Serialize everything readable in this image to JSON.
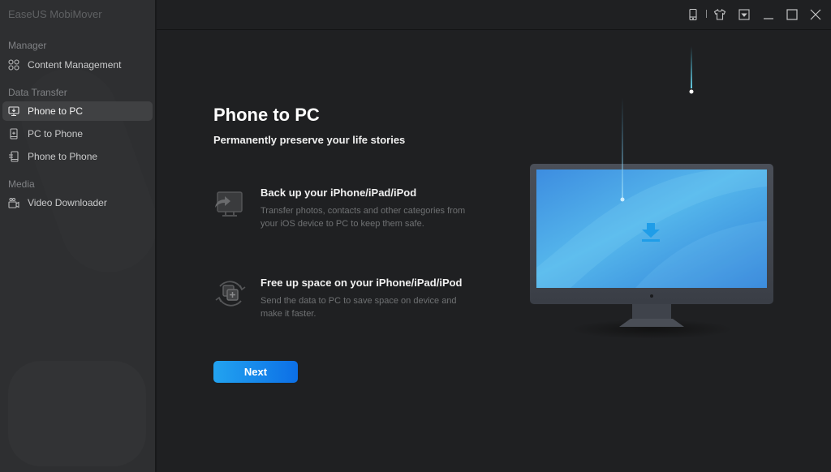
{
  "app": {
    "title": "EaseUS MobiMover"
  },
  "sidebar": {
    "sections": [
      {
        "label": "Manager",
        "items": [
          {
            "label": "Content Management",
            "icon": "grid-icon",
            "active": false
          }
        ]
      },
      {
        "label": "Data Transfer",
        "items": [
          {
            "label": "Phone to PC",
            "icon": "monitor-download-icon",
            "active": true
          },
          {
            "label": "PC to Phone",
            "icon": "phone-plus-icon",
            "active": false
          },
          {
            "label": "Phone to Phone",
            "icon": "phone-transfer-icon",
            "active": false
          }
        ]
      },
      {
        "label": "Media",
        "items": [
          {
            "label": "Video Downloader",
            "icon": "video-camera-icon",
            "active": false
          }
        ]
      }
    ]
  },
  "titlebar": {
    "buttons": [
      "device-icon",
      "skin-shirt-icon",
      "menu-dropdown-icon",
      "minimize-icon",
      "maximize-icon",
      "close-icon"
    ]
  },
  "main": {
    "title": "Phone to PC",
    "subtitle": "Permanently preserve your life stories",
    "features": [
      {
        "title": "Back up your iPhone/iPad/iPod",
        "description": "Transfer photos, contacts and other categories from your iOS device to PC to keep them safe.",
        "icon": "monitor-backup-icon"
      },
      {
        "title": "Free up space on your iPhone/iPad/iPod",
        "description": "Send the data to PC to save space on device and make it faster.",
        "icon": "free-space-icon"
      }
    ],
    "next_label": "Next"
  },
  "colors": {
    "accent_start": "#22a3f0",
    "accent_end": "#0c6fe6",
    "screen_blue": "#3a9ee8"
  }
}
